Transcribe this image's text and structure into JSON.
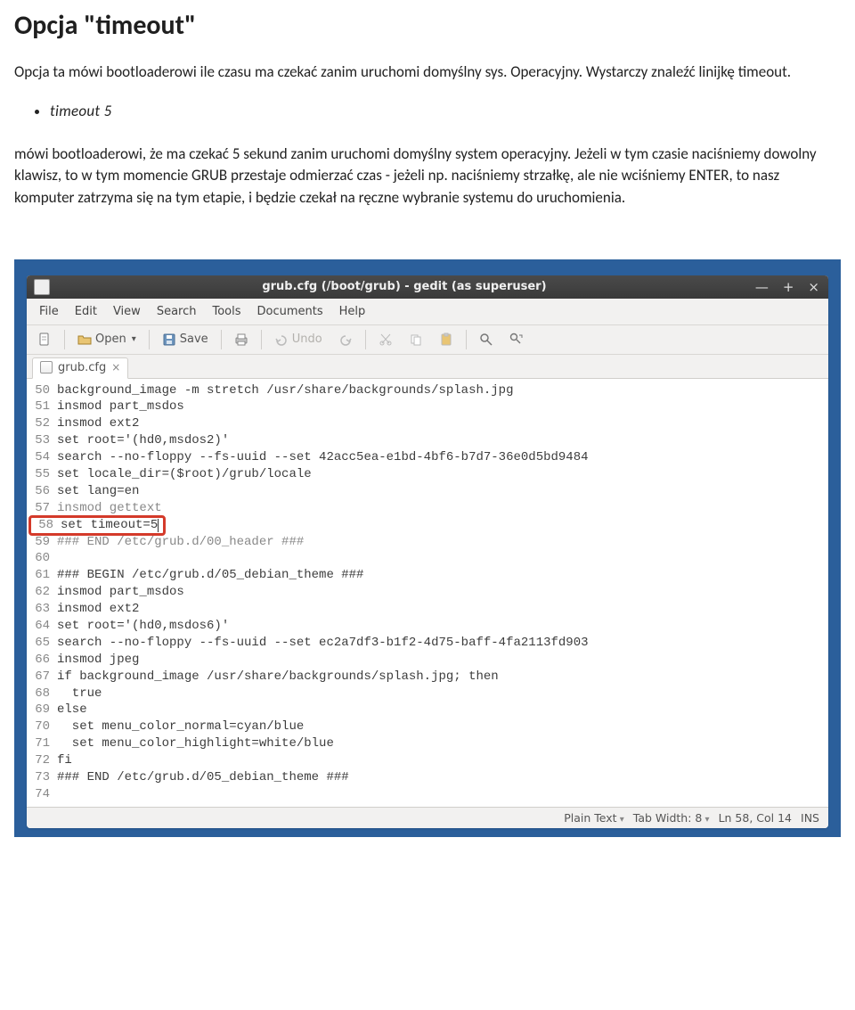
{
  "doc": {
    "title": "Opcja \"timeout\"",
    "p1": "Opcja ta mówi bootloaderowi ile czasu ma czekać zanim uruchomi domyślny sys. Operacyjny. Wystarczy znaleźć linijkę timeout.",
    "bullet": "timeout    5",
    "p2": "mówi bootloaderowi, że ma czekać 5 sekund zanim uruchomi domyślny system operacyjny. Jeżeli w tym czasie naciśniemy dowolny klawisz, to w tym momencie GRUB przestaje odmierzać czas - jeżeli np. naciśniemy strzałkę, ale nie wciśniemy ENTER, to nasz komputer zatrzyma się na tym etapie, i będzie czekał na ręczne wybranie systemu do uruchomienia."
  },
  "window": {
    "title": "grub.cfg (/boot/grub) - gedit (as superuser)"
  },
  "menu": {
    "file": "File",
    "edit": "Edit",
    "view": "View",
    "search": "Search",
    "tools": "Tools",
    "documents": "Documents",
    "help": "Help"
  },
  "toolbar": {
    "open": "Open",
    "save": "Save",
    "undo": "Undo"
  },
  "tab": {
    "filename": "grub.cfg"
  },
  "code": [
    {
      "n": "50",
      "t": "background_image -m stretch /usr/share/backgrounds/splash.jpg"
    },
    {
      "n": "51",
      "t": "insmod part_msdos"
    },
    {
      "n": "52",
      "t": "insmod ext2"
    },
    {
      "n": "53",
      "t": "set root='(hd0,msdos2)'"
    },
    {
      "n": "54",
      "t": "search --no-floppy --fs-uuid --set 42acc5ea-e1bd-4bf6-b7d7-36e0d5bd9484"
    },
    {
      "n": "55",
      "t": "set locale_dir=($root)/grub/locale"
    },
    {
      "n": "56",
      "t": "set lang=en"
    },
    {
      "n": "57",
      "t": "insmod gettext",
      "scratch": true
    },
    {
      "n": "58",
      "t": "set timeout=5",
      "highlighted": true
    },
    {
      "n": "59",
      "t": "### END /etc/grub.d/00_header ###",
      "scratch": true
    },
    {
      "n": "60",
      "t": ""
    },
    {
      "n": "61",
      "t": "### BEGIN /etc/grub.d/05_debian_theme ###"
    },
    {
      "n": "62",
      "t": "insmod part_msdos"
    },
    {
      "n": "63",
      "t": "insmod ext2"
    },
    {
      "n": "64",
      "t": "set root='(hd0,msdos6)'"
    },
    {
      "n": "65",
      "t": "search --no-floppy --fs-uuid --set ec2a7df3-b1f2-4d75-baff-4fa2113fd903"
    },
    {
      "n": "66",
      "t": "insmod jpeg"
    },
    {
      "n": "67",
      "t": "if background_image /usr/share/backgrounds/splash.jpg; then"
    },
    {
      "n": "68",
      "t": "  true"
    },
    {
      "n": "69",
      "t": "else"
    },
    {
      "n": "70",
      "t": "  set menu_color_normal=cyan/blue"
    },
    {
      "n": "71",
      "t": "  set menu_color_highlight=white/blue"
    },
    {
      "n": "72",
      "t": "fi"
    },
    {
      "n": "73",
      "t": "### END /etc/grub.d/05_debian_theme ###"
    },
    {
      "n": "74",
      "t": ""
    }
  ],
  "status": {
    "lang": "Plain Text",
    "tabwidth": "Tab Width: 8",
    "pos": "Ln 58, Col 14",
    "ins": "INS"
  }
}
